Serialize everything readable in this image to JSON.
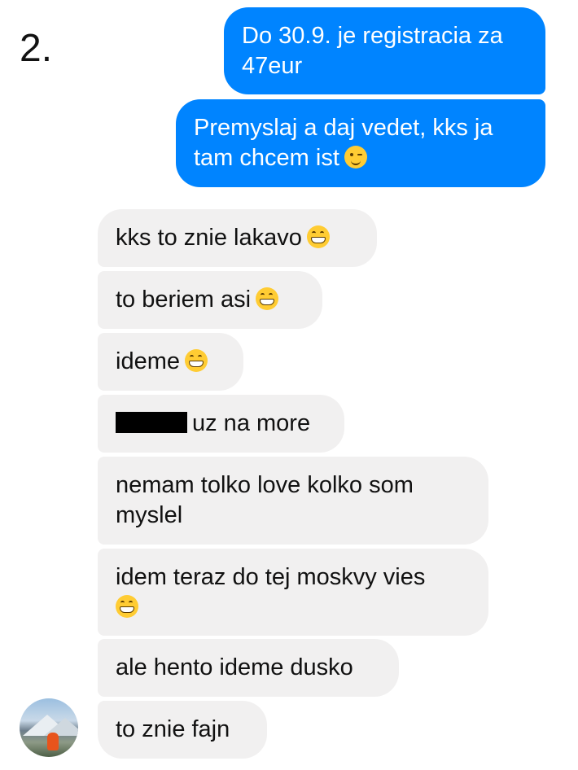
{
  "page_label": "2.",
  "colors": {
    "outgoing_bubble": "#0084ff",
    "incoming_bubble": "#f1f0f0"
  },
  "messages": [
    {
      "direction": "outgoing",
      "lines": [
        "Do 30.9. je registracia za",
        "47eur"
      ]
    },
    {
      "direction": "outgoing",
      "lines": [
        "Premyslaj a daj vedet, kks ja",
        "tam chcem ist"
      ],
      "emoji": "winking-face-icon"
    },
    {
      "direction": "incoming",
      "text": "kks to znie lakavo",
      "emoji": "grinning-face-icon"
    },
    {
      "direction": "incoming",
      "text": "to beriem asi",
      "emoji": "grinning-face-icon"
    },
    {
      "direction": "incoming",
      "text": "ideme",
      "emoji": "grinning-face-icon"
    },
    {
      "direction": "incoming",
      "text": "uz na more",
      "redacted_prefix": true
    },
    {
      "direction": "incoming",
      "lines": [
        "nemam tolko love kolko som",
        "myslel"
      ]
    },
    {
      "direction": "incoming",
      "lines": [
        "idem teraz do tej moskvy vies"
      ],
      "emoji": "grinning-face-icon"
    },
    {
      "direction": "incoming",
      "text": "ale hento ideme dusko"
    },
    {
      "direction": "incoming",
      "text": "to znie fajn"
    }
  ]
}
